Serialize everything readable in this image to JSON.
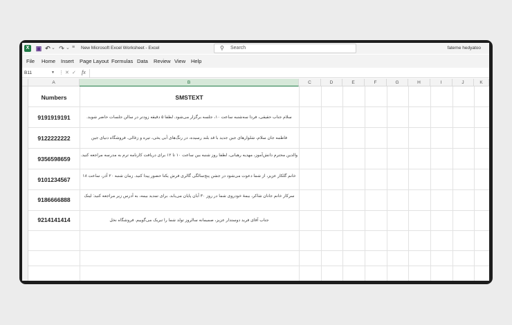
{
  "titlebar": {
    "logo": "X",
    "doc_title": "New Microsoft Excel Worksheet  -  Excel",
    "search_placeholder": "Search",
    "user": "fateme hedyatoo"
  },
  "menu": [
    "File",
    "Home",
    "Insert",
    "Page Layout",
    "Formulas",
    "Data",
    "Review",
    "View",
    "Help"
  ],
  "formula_bar": {
    "name_box": "B11",
    "fx": "fx",
    "value": ""
  },
  "columns": [
    "A",
    "B",
    "C",
    "D",
    "E",
    "F",
    "G",
    "H",
    "I",
    "J",
    "K"
  ],
  "sheet": {
    "headers": {
      "numbers": "Numbers",
      "sms": "SMSTEXT"
    },
    "rows": [
      {
        "number": "9191919191",
        "sms": "سلام جناب حقیقی، فردا سه‌شنبه ساعت ۱۰، جلسه برگزار می‌شود. لطفا ۵ دقیقه زودتر در سالن جلسات حاضر شوید."
      },
      {
        "number": "9122222222",
        "sms": "فاطمه جان سلام، شلوارهای جین جدید با قد بلند رسیده، در رنگ‌های آبی یخی، تیره و زغالی. فروشگاه دنیای جین"
      },
      {
        "number": "9356598659",
        "sms": "والدین محترم دانش‌آموز، مهدیه رهبانی، لطفا روز شنبه بین ساعت ۱۰ تا ۱۲ برای دریافت کارنامه ترم به مدرسه مراجعه کنید."
      },
      {
        "number": "9101234567",
        "sms": "خانم گلکار عزیز، از شما دعوت می‌شود در جشن پنج‌سالگی گالری فرش یکتا حضور پیدا کنید. زمان شنبه ۲۰ آذر، ساعت ۱۸"
      },
      {
        "number": "9186666888",
        "sms": "سرکار خانم جانان شاکر، بیمهٔ خودروی شما در روز ۳۰ آبان پایان می‌یابد. برای تمدید بیمه، به آدرس زیر مراجعه کنید: لینک"
      },
      {
        "number": "9214141414",
        "sms": "جناب آقای فرید دوستدار عزیز، صمیمانه سالروز تولد شما را تبریک می‌گوییم. فروشگاه نخل"
      }
    ]
  }
}
